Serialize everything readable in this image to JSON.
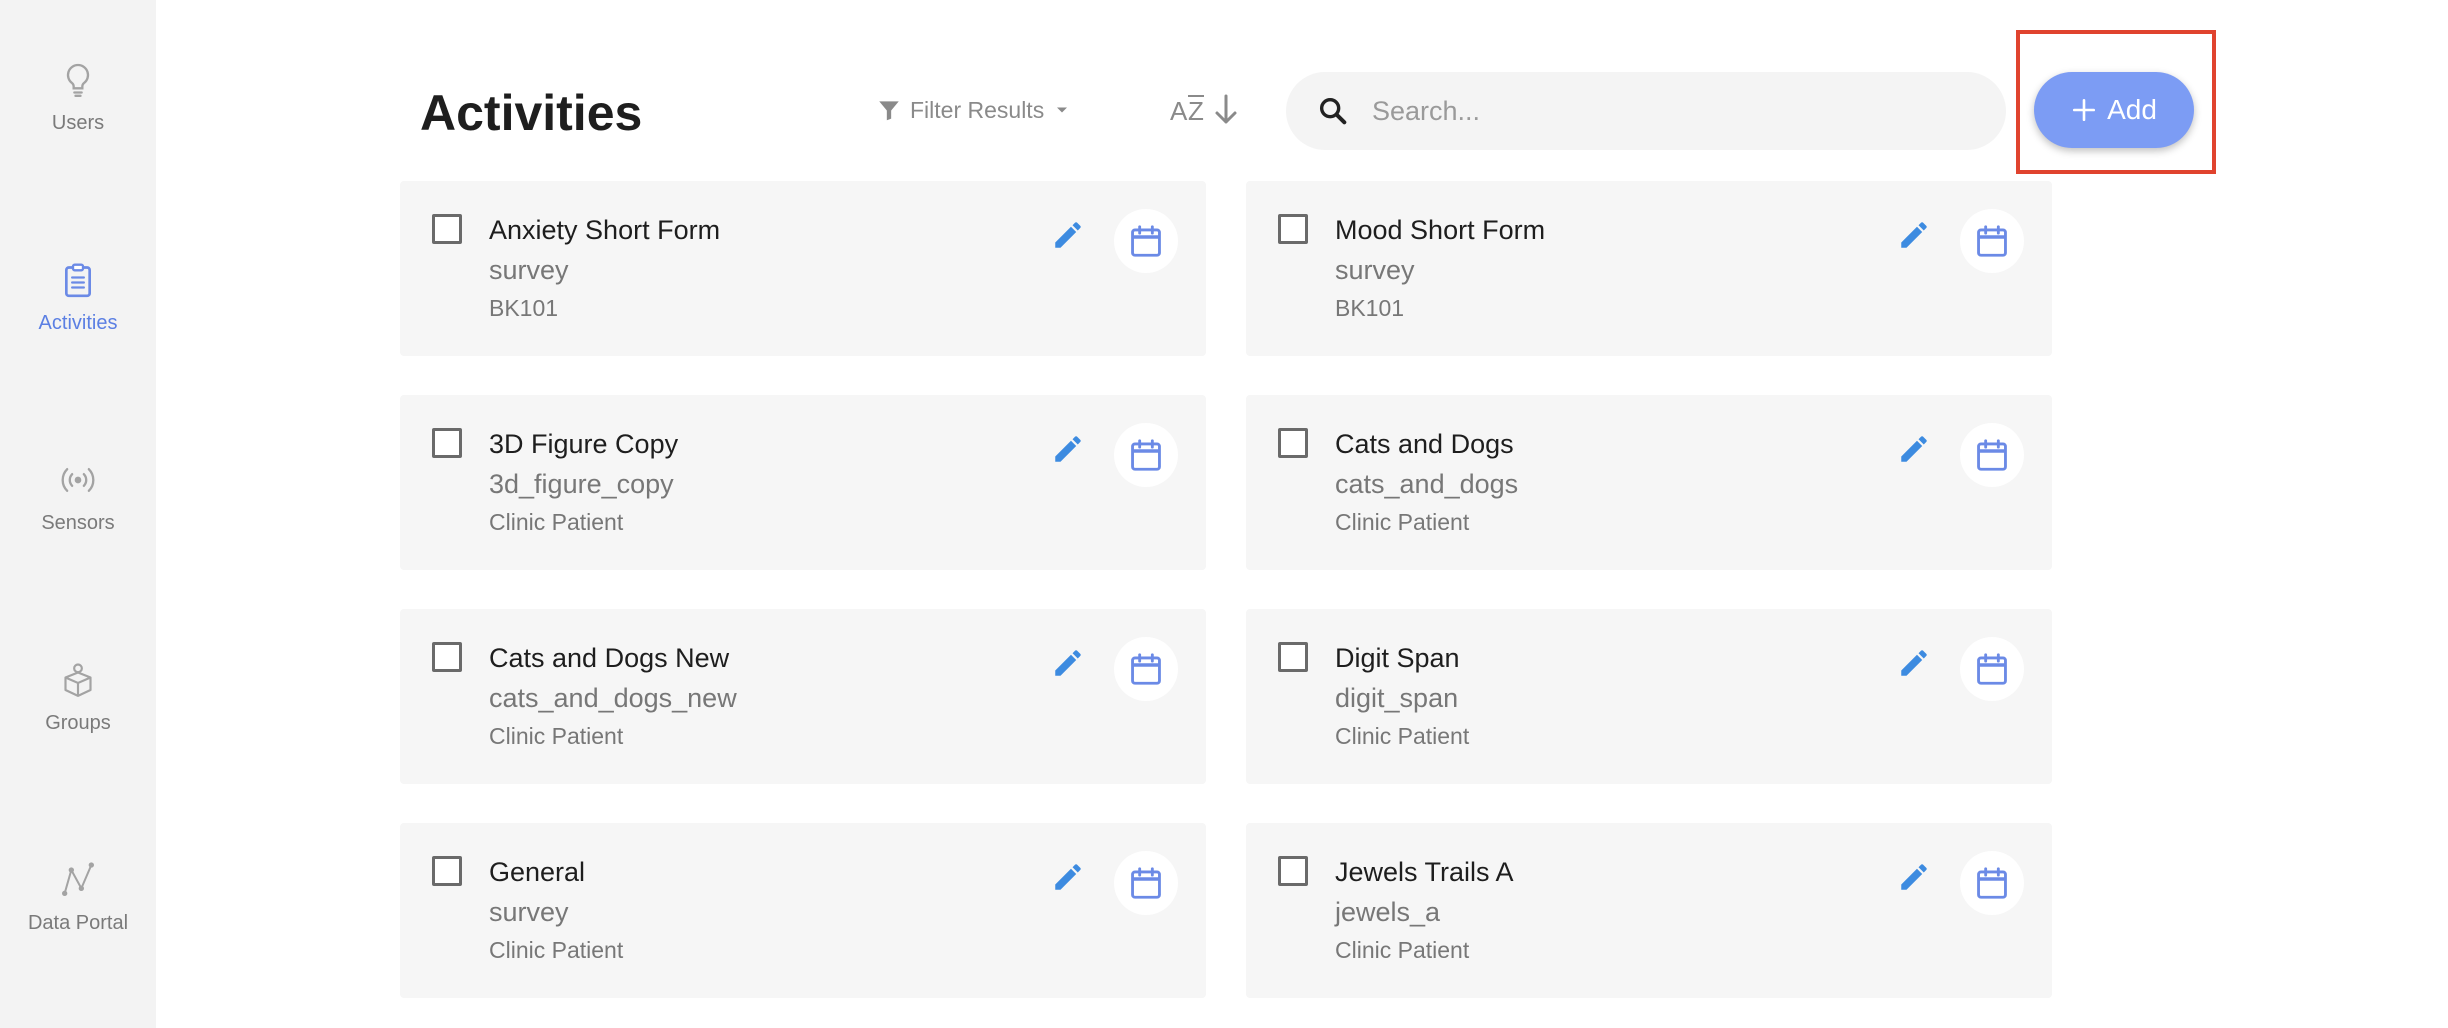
{
  "sidebar": {
    "items": [
      {
        "label": "Users",
        "icon": "lightbulb-icon",
        "active": false
      },
      {
        "label": "Activities",
        "icon": "clipboard-icon",
        "active": true
      },
      {
        "label": "Sensors",
        "icon": "broadcast-icon",
        "active": false
      },
      {
        "label": "Groups",
        "icon": "people-box-icon",
        "active": false
      },
      {
        "label": "Data Portal",
        "icon": "data-graph-icon",
        "active": false
      }
    ]
  },
  "header": {
    "title": "Activities",
    "filter_label": "Filter Results",
    "sort_icon": "sort-az-icon",
    "search_placeholder": "Search...",
    "search_value": "",
    "add_label": "Add"
  },
  "activities": [
    {
      "title": "Anxiety Short Form",
      "subtitle": "survey",
      "tag": "BK101"
    },
    {
      "title": "Mood Short Form",
      "subtitle": "survey",
      "tag": "BK101"
    },
    {
      "title": "3D Figure Copy",
      "subtitle": "3d_figure_copy",
      "tag": "Clinic Patient"
    },
    {
      "title": "Cats and Dogs",
      "subtitle": "cats_and_dogs",
      "tag": "Clinic Patient"
    },
    {
      "title": "Cats and Dogs New",
      "subtitle": "cats_and_dogs_new",
      "tag": "Clinic Patient"
    },
    {
      "title": "Digit Span",
      "subtitle": "digit_span",
      "tag": "Clinic Patient"
    },
    {
      "title": "General",
      "subtitle": "survey",
      "tag": "Clinic Patient"
    },
    {
      "title": "Jewels Trails A",
      "subtitle": "jewels_a",
      "tag": "Clinic Patient"
    }
  ],
  "colors": {
    "accent": "#7c9cf4",
    "active_nav": "#5b7fe3",
    "edit_icon": "#3d8be0",
    "highlight": "#e0432e"
  }
}
